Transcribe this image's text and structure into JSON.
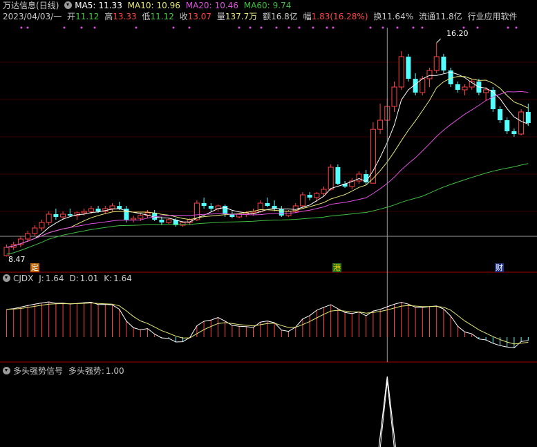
{
  "header": {
    "stock_name": "万达信息",
    "period": "(日线)",
    "ma5_label": "MA5:",
    "ma5": "11.33",
    "ma10_label": "MA10:",
    "ma10": "10.96",
    "ma20_label": "MA20:",
    "ma20": "10.46",
    "ma60_label": "MA60:",
    "ma60": "9.74"
  },
  "quote": {
    "date": "2023/04/03/一",
    "open_label": "开",
    "open": "11.12",
    "high_label": "高",
    "high": "13.33",
    "low_label": "低",
    "low": "11.12",
    "close_label": "收",
    "close": "13.07",
    "volume_label": "量",
    "volume": "137.7万",
    "amount_label": "额",
    "amount": "16.8亿",
    "change_label": "幅",
    "change": "1.83(16.28%)",
    "turnover_label": "换",
    "turnover": "11.64%",
    "float_label": "流通",
    "float": "11.8亿",
    "industry": "行业应用软件"
  },
  "price_chart": {
    "high_marker": "16.20",
    "low_marker": "8.47",
    "events": [
      "定",
      "港",
      "财"
    ]
  },
  "cjdx": {
    "name": "CJDX",
    "j_label": "J:",
    "j": "1.64",
    "d_label": "D:",
    "d": "1.01",
    "k_label": "K:",
    "k": "1.64"
  },
  "signal": {
    "name": "多头强势信号",
    "series_label": "多头强势:",
    "value": "1.00"
  },
  "colors": {
    "up": "#ff4444",
    "down": "#54ffff",
    "ma5": "#ffffff",
    "ma10": "#e8e87a",
    "ma20": "#e050e0",
    "ma60": "#40c040",
    "panel_border": "#8b0000"
  },
  "chart_data": {
    "type": "candlestick",
    "ohlc": [
      [
        8.5,
        8.9,
        8.47,
        8.8
      ],
      [
        8.8,
        9.0,
        8.7,
        8.9
      ],
      [
        8.9,
        9.2,
        8.8,
        9.1
      ],
      [
        9.1,
        9.4,
        9.0,
        9.3
      ],
      [
        9.3,
        9.6,
        9.2,
        9.5
      ],
      [
        9.5,
        9.8,
        9.4,
        9.7
      ],
      [
        9.7,
        10.1,
        9.6,
        10.0
      ],
      [
        10.0,
        10.2,
        9.8,
        9.9
      ],
      [
        9.9,
        10.1,
        9.8,
        10.0
      ],
      [
        10.0,
        10.2,
        9.9,
        9.95
      ],
      [
        9.95,
        10.1,
        9.8,
        10.05
      ],
      [
        10.05,
        10.2,
        9.95,
        10.1
      ],
      [
        10.1,
        10.3,
        10.0,
        10.2
      ],
      [
        10.2,
        10.3,
        10.05,
        10.1
      ],
      [
        10.1,
        10.3,
        10.0,
        10.2
      ],
      [
        10.2,
        10.4,
        10.1,
        10.3
      ],
      [
        10.3,
        10.45,
        10.15,
        10.2
      ],
      [
        10.2,
        10.3,
        9.7,
        9.8
      ],
      [
        9.8,
        9.95,
        9.7,
        9.85
      ],
      [
        9.85,
        10.05,
        9.75,
        9.95
      ],
      [
        9.95,
        10.15,
        9.85,
        10.05
      ],
      [
        10.05,
        10.15,
        9.75,
        9.8
      ],
      [
        9.8,
        9.9,
        9.6,
        9.7
      ],
      [
        9.7,
        9.85,
        9.65,
        9.8
      ],
      [
        9.8,
        9.85,
        9.55,
        9.6
      ],
      [
        9.6,
        9.75,
        9.55,
        9.7
      ],
      [
        9.7,
        9.85,
        9.6,
        9.8
      ],
      [
        9.8,
        10.5,
        9.75,
        10.4
      ],
      [
        10.4,
        10.6,
        10.2,
        10.3
      ],
      [
        10.3,
        10.4,
        10.1,
        10.2
      ],
      [
        10.2,
        10.35,
        10.1,
        10.3
      ],
      [
        10.3,
        10.35,
        9.9,
        10.0
      ],
      [
        10.0,
        10.1,
        9.85,
        9.9
      ],
      [
        9.9,
        10.05,
        9.85,
        10.0
      ],
      [
        10.0,
        10.1,
        9.9,
        10.05
      ],
      [
        10.05,
        10.2,
        9.95,
        10.1
      ],
      [
        10.1,
        10.5,
        10.05,
        10.4
      ],
      [
        10.4,
        10.6,
        10.25,
        10.3
      ],
      [
        10.3,
        10.5,
        10.1,
        10.2
      ],
      [
        10.2,
        10.3,
        9.9,
        9.95
      ],
      [
        9.95,
        10.15,
        9.9,
        10.1
      ],
      [
        10.1,
        10.4,
        10.05,
        10.3
      ],
      [
        10.3,
        10.8,
        10.25,
        10.7
      ],
      [
        10.7,
        10.8,
        10.5,
        10.6
      ],
      [
        10.6,
        10.8,
        10.45,
        10.75
      ],
      [
        10.75,
        11.0,
        10.65,
        10.9
      ],
      [
        10.9,
        11.8,
        10.85,
        11.7
      ],
      [
        11.7,
        11.8,
        11.05,
        11.1
      ],
      [
        11.1,
        11.2,
        10.95,
        11.0
      ],
      [
        11.0,
        11.3,
        10.9,
        11.2
      ],
      [
        11.2,
        11.55,
        11.1,
        11.45
      ],
      [
        11.45,
        11.6,
        11.05,
        11.15
      ],
      [
        11.12,
        13.33,
        11.12,
        13.07
      ],
      [
        13.07,
        14.0,
        12.9,
        13.4
      ],
      [
        13.4,
        14.2,
        13.2,
        13.9
      ],
      [
        13.9,
        14.8,
        13.7,
        14.6
      ],
      [
        14.6,
        15.9,
        14.5,
        15.7
      ],
      [
        15.7,
        15.8,
        14.8,
        14.9
      ],
      [
        14.9,
        15.1,
        14.3,
        14.4
      ],
      [
        14.4,
        15.0,
        14.3,
        14.9
      ],
      [
        14.9,
        15.3,
        14.6,
        15.2
      ],
      [
        15.2,
        16.2,
        15.1,
        15.7
      ],
      [
        15.7,
        15.8,
        15.1,
        15.2
      ],
      [
        15.2,
        15.3,
        14.6,
        14.7
      ],
      [
        14.7,
        14.8,
        14.4,
        14.5
      ],
      [
        14.5,
        14.7,
        14.3,
        14.6
      ],
      [
        14.6,
        14.9,
        14.5,
        14.8
      ],
      [
        14.8,
        14.9,
        14.3,
        14.4
      ],
      [
        14.4,
        14.6,
        14.1,
        14.5
      ],
      [
        14.5,
        14.6,
        13.7,
        13.8
      ],
      [
        13.8,
        13.9,
        13.3,
        13.4
      ],
      [
        13.4,
        13.5,
        12.9,
        13.0
      ],
      [
        13.0,
        13.1,
        12.8,
        12.9
      ],
      [
        12.9,
        13.8,
        12.85,
        13.7
      ],
      [
        13.7,
        14.0,
        13.2,
        13.3
      ]
    ],
    "series": [
      {
        "name": "MA5",
        "last": 11.33
      },
      {
        "name": "MA10",
        "last": 10.96
      },
      {
        "name": "MA20",
        "last": 10.46
      },
      {
        "name": "MA60",
        "last": 9.74
      }
    ]
  }
}
